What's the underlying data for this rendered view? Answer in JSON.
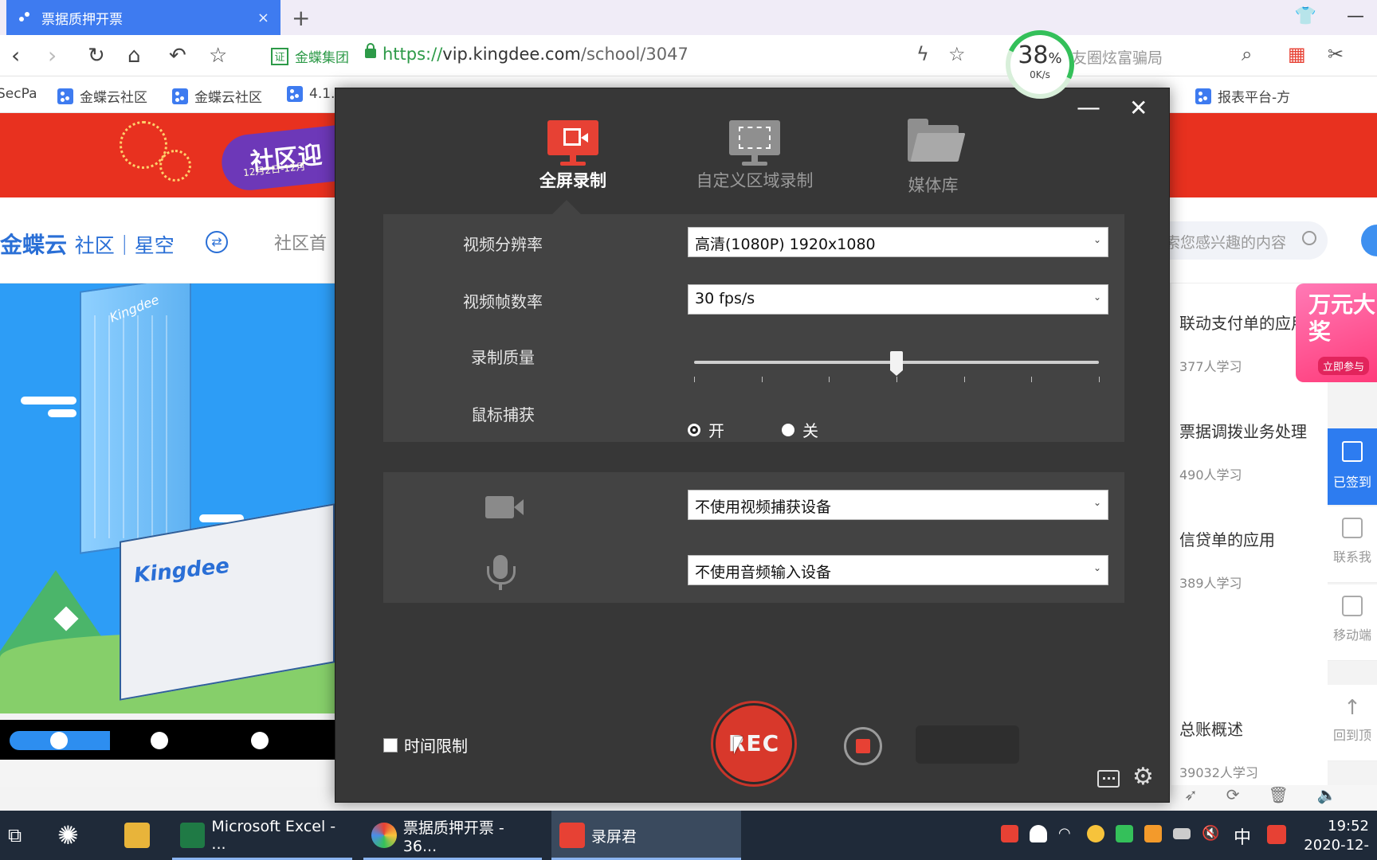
{
  "browser": {
    "tab_title": "票据质押开票",
    "tab_close": "×",
    "new_tab": "+",
    "cert_badge": "证",
    "cert_org": "金蝶集团",
    "url_scheme": "https://",
    "url_host": "vip.kingdee.com",
    "url_path": "/school/3047",
    "search_hint": "友圈炫富骗局",
    "speed_percent": "38",
    "speed_unit": "%",
    "speed_rate": "0K/s",
    "bookmarks": [
      "SecPa",
      "金蝶云社区",
      "金蝶云社区",
      "4.1.",
      "报表平台-方"
    ]
  },
  "page": {
    "banner_text": "社区迎",
    "banner_dates": "12月2日-12月",
    "logo_main": "金蝶云",
    "logo_sub": "社区｜星空",
    "nav_item": "社区首",
    "search_placeholder": "索您感兴趣的内容",
    "tower_label": "Kingdee",
    "block_label": "Kingdee",
    "promo_text": "万元大奖",
    "promo_button": "立即参与",
    "courses": [
      {
        "title": "联动支付单的应用",
        "count": "377人学习"
      },
      {
        "title": "票据调拨业务处理",
        "count": "490人学习"
      },
      {
        "title": "信贷单的应用",
        "count": "389人学习"
      },
      {
        "title": "总账概述",
        "count": "39032人学习"
      }
    ],
    "float_checkin": "已签到",
    "float_contact": "联系我",
    "float_mobile": "移动端",
    "float_top": "回到顶"
  },
  "recorder": {
    "modes": [
      {
        "label": "全屏录制",
        "active": true
      },
      {
        "label": "自定义区域录制",
        "active": false
      },
      {
        "label": "媒体库",
        "active": false
      }
    ],
    "resolution_label": "视频分辨率",
    "resolution_value": "高清(1080P)   1920x1080",
    "framerate_label": "视频帧数率",
    "framerate_value": "30 fps/s",
    "quality_label": "录制质量",
    "quality_level": 0.5,
    "mouse_label": "鼠标捕获",
    "mouse_on": "开",
    "mouse_off": "关",
    "video_device": "不使用视频捕获设备",
    "audio_device": "不使用音频输入设备",
    "time_limit_label": "时间限制",
    "rec_label": "REC",
    "minimize": "—",
    "close": "✕"
  },
  "taskbar": {
    "apps": [
      {
        "label": "Microsoft Excel - ...",
        "color": "#1f7a45"
      },
      {
        "label": "票据质押开票 - 36...",
        "color": "#4a8de8"
      },
      {
        "label": "录屏君",
        "color": "#e74134"
      }
    ],
    "ime": "中",
    "time": "19:52",
    "date": "2020-12-"
  }
}
